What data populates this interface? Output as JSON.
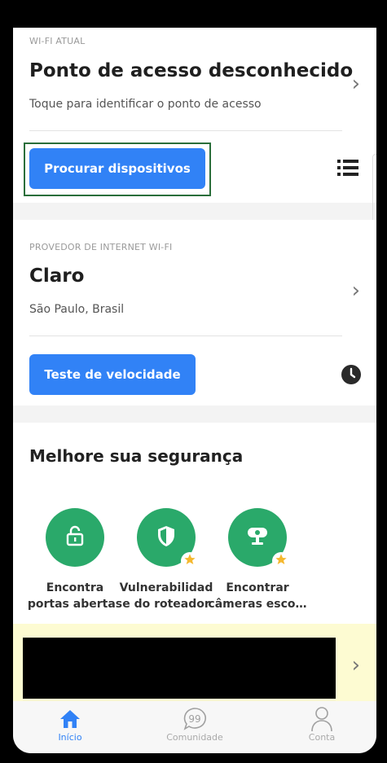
{
  "wifi": {
    "section_label": "WI-FI ATUAL",
    "title": "Ponto de acesso desconhecido",
    "subtitle": "Toque para identificar o ponto de acesso",
    "scan_button": "Procurar dispositivos",
    "list_icon": "list-icon"
  },
  "isp": {
    "section_label": "PROVEDOR DE INTERNET WI-FI",
    "name": "Claro",
    "location": "São Paulo, Brasil",
    "speed_button": "Teste de velocidade",
    "history_icon": "clock-icon"
  },
  "security": {
    "title": "Melhore sua segurança",
    "features": [
      {
        "line1": "Encontra",
        "line2": "portas abertas",
        "icon": "lock-icon",
        "premium": false
      },
      {
        "line1": "Vulnerabilidad",
        "line2": "e do roteador",
        "icon": "shield-icon",
        "premium": true
      },
      {
        "line1": "Encontrar",
        "line2": "câmeras esco…",
        "icon": "camera-icon",
        "premium": true
      }
    ]
  },
  "tabs": [
    {
      "label": "Início",
      "icon": "home-icon",
      "active": true
    },
    {
      "label": "Comunidade",
      "icon": "chat-icon",
      "active": false
    },
    {
      "label": "Conta",
      "icon": "user-icon",
      "active": false
    }
  ],
  "colors": {
    "accent": "#3182f6",
    "feature_green": "#2aa96a",
    "banner_bg": "#fdfbd2",
    "star": "#f5b82e"
  }
}
